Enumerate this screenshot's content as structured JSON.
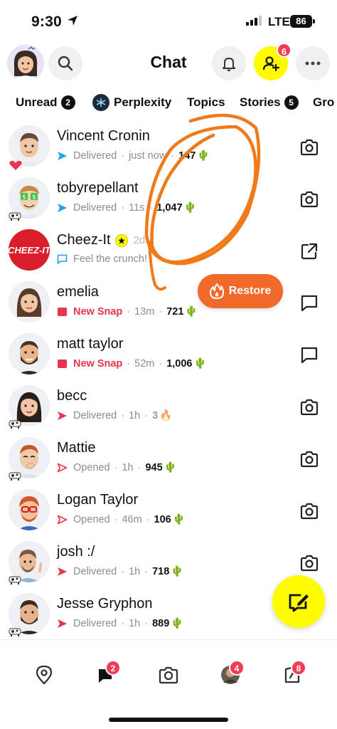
{
  "status_bar": {
    "time": "9:30",
    "network": "LTE",
    "battery": "86"
  },
  "header": {
    "title": "Chat",
    "add_friend_badge": "6"
  },
  "filters": [
    {
      "label": "Unread",
      "badge": "2"
    },
    {
      "label": "Perplexity",
      "badge": ""
    },
    {
      "label": "Topics",
      "badge": ""
    },
    {
      "label": "Stories",
      "badge": "5"
    },
    {
      "label": "Gro",
      "badge": ""
    }
  ],
  "chats": [
    {
      "name": "Vincent Cronin",
      "status": "Delivered",
      "time": "just now",
      "streak": "147",
      "streak_icon": "cactus",
      "status_icon": "delivered-chat-arrow",
      "action": "camera"
    },
    {
      "name": "tobyrepellant",
      "status": "Delivered",
      "time": "11s",
      "streak": "1,047",
      "streak_icon": "cactus",
      "status_icon": "delivered-chat-arrow",
      "action": "camera"
    },
    {
      "name": "Cheez-It",
      "status": "Feel the crunch!",
      "time": "2d",
      "streak": "",
      "streak_icon": "",
      "status_icon": "chat-outline",
      "action": "open-external"
    },
    {
      "name": "emelia",
      "status": "New Snap",
      "time": "13m",
      "streak": "721",
      "streak_icon": "cactus",
      "status_icon": "new-snap-square",
      "action": "chat"
    },
    {
      "name": "matt taylor",
      "status": "New Snap",
      "time": "52m",
      "streak": "1,006",
      "streak_icon": "cactus",
      "status_icon": "new-snap-square",
      "action": "chat"
    },
    {
      "name": "becc",
      "status": "Delivered",
      "time": "1h",
      "streak": "3",
      "streak_icon": "fire",
      "status_icon": "delivered-snap-arrow",
      "action": "camera"
    },
    {
      "name": "Mattie",
      "status": "Opened",
      "time": "1h",
      "streak": "945",
      "streak_icon": "cactus",
      "status_icon": "opened-snap-arrow",
      "action": "camera"
    },
    {
      "name": "Logan Taylor",
      "status": "Opened",
      "time": "46m",
      "streak": "106",
      "streak_icon": "cactus",
      "status_icon": "opened-snap-arrow",
      "action": "camera"
    },
    {
      "name": "josh :/",
      "status": "Delivered",
      "time": "1h",
      "streak": "718",
      "streak_icon": "cactus",
      "status_icon": "delivered-snap-arrow",
      "action": "camera"
    },
    {
      "name": "Jesse Gryphon",
      "status": "Delivered",
      "time": "1h",
      "streak": "889",
      "streak_icon": "cactus",
      "status_icon": "delivered-snap-arrow",
      "action": "camera"
    }
  ],
  "restore": {
    "label": "Restore"
  },
  "bottom_nav": [
    {
      "name": "map",
      "badge": ""
    },
    {
      "name": "chat",
      "badge": "2"
    },
    {
      "name": "camera",
      "badge": ""
    },
    {
      "name": "stories",
      "badge": "4"
    },
    {
      "name": "spotlight",
      "badge": "8"
    }
  ],
  "colors": {
    "snap_yellow": "#fffc00",
    "badge_red": "#f23c57",
    "new_snap_red": "#e8344e",
    "chat_blue": "#1ea1f2",
    "restore_orange": "#f26a2a",
    "scribble_orange": "#f07a1a"
  }
}
